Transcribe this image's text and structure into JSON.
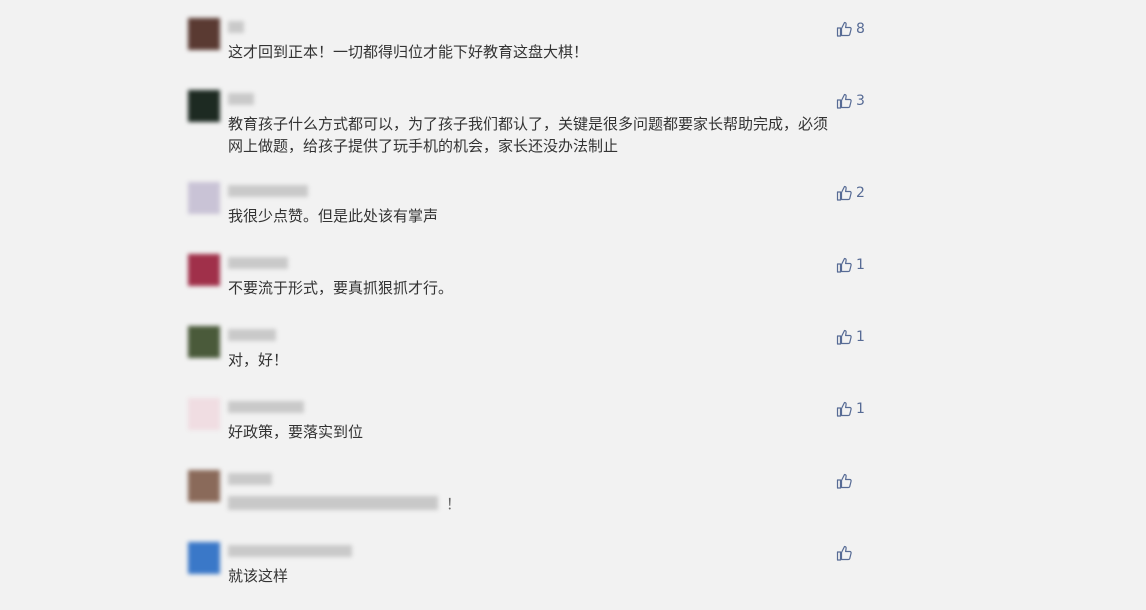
{
  "comments": [
    {
      "text": "这才回到正本！一切都得归位才能下好教育这盘大棋！",
      "likes": "8",
      "avatar_color": "#5a3a32"
    },
    {
      "text": "教育孩子什么方式都可以，为了孩子我们都认了，关键是很多问题都要家长帮助完成，必须网上做题，给孩子提供了玩手机的机会，家长还没办法制止",
      "likes": "3",
      "avatar_color": "#1d2a22"
    },
    {
      "text": "我很少点赞。但是此处该有掌声",
      "likes": "2",
      "avatar_color": "#c9c3d6"
    },
    {
      "text": "不要流于形式，要真抓狠抓才行。",
      "likes": "1",
      "avatar_color": "#a0304a"
    },
    {
      "text": "对，好！",
      "likes": "1",
      "avatar_color": "#4a5a3a"
    },
    {
      "text": "好政策，要落实到位",
      "likes": "1",
      "avatar_color": "#f0dde2"
    },
    {
      "text": "！",
      "likes": "",
      "avatar_color": "#8a6a5a"
    },
    {
      "text": "就该这样",
      "likes": "",
      "avatar_color": "#3a78c8"
    }
  ],
  "icons": {
    "like": "thumbs-up-icon"
  },
  "colors": {
    "like": "#576b95",
    "background": "#f2f2f2"
  }
}
